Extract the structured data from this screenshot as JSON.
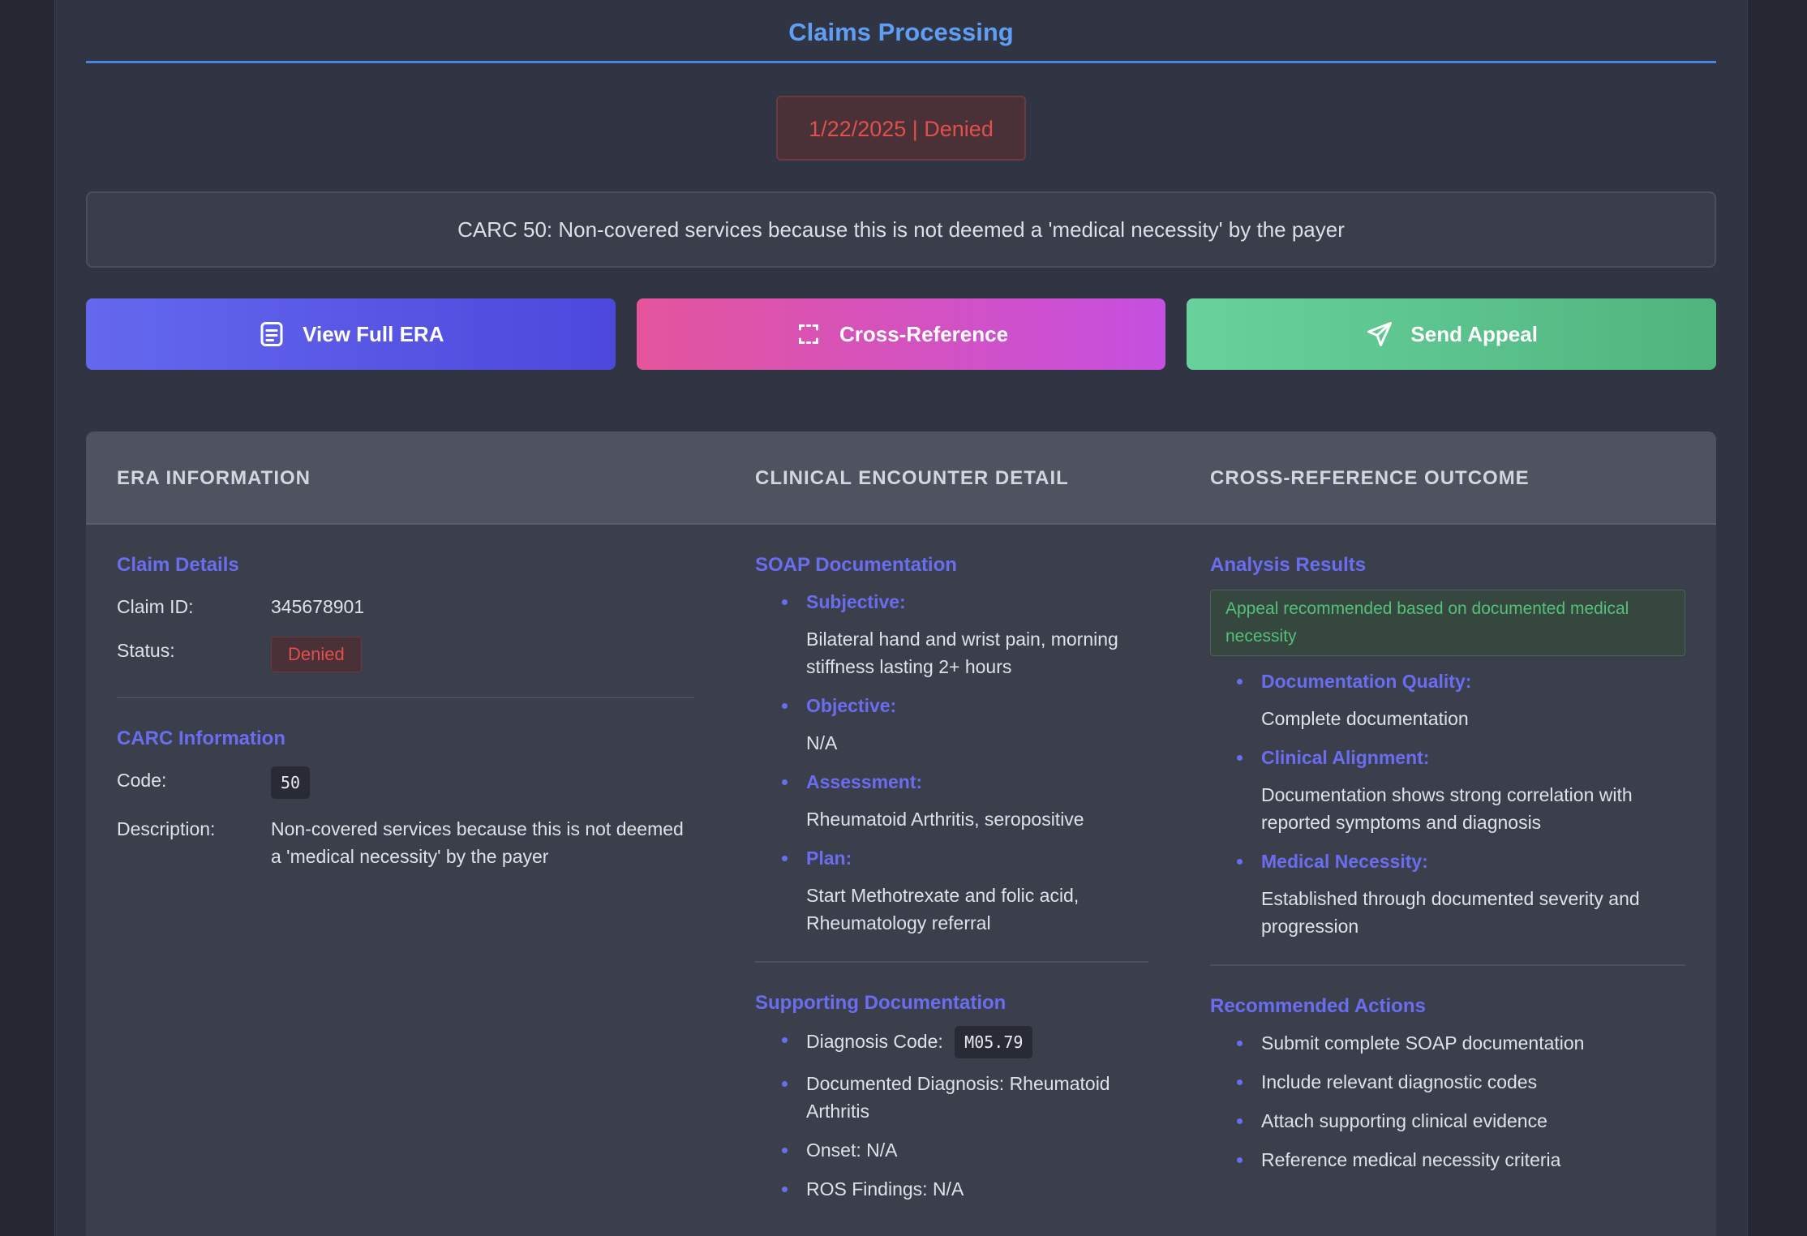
{
  "header": {
    "title": "Claims Processing"
  },
  "status_pill": "1/22/2025 | Denied",
  "carc_banner": "CARC 50: Non-covered services because this is not deemed a 'medical necessity' by the payer",
  "buttons": {
    "view_era": "View Full ERA",
    "cross_reference": "Cross-Reference",
    "send_appeal": "Send Appeal"
  },
  "columns": {
    "era": "ERA INFORMATION",
    "clinical": "CLINICAL ENCOUNTER DETAIL",
    "outcome": "CROSS-REFERENCE OUTCOME"
  },
  "era": {
    "claim_details_title": "Claim Details",
    "claim_id_label": "Claim ID:",
    "claim_id": "345678901",
    "status_label": "Status:",
    "status": "Denied",
    "carc_title": "CARC Information",
    "code_label": "Code:",
    "code": "50",
    "description_label": "Description:",
    "description": "Non-covered services because this is not deemed a 'medical necessity' by the payer"
  },
  "clinical": {
    "soap_title": "SOAP Documentation",
    "soap": [
      {
        "label": "Subjective:",
        "text": "Bilateral hand and wrist pain, morning stiffness lasting 2+ hours"
      },
      {
        "label": "Objective:",
        "text": "N/A"
      },
      {
        "label": "Assessment:",
        "text": "Rheumatoid Arthritis, seropositive"
      },
      {
        "label": "Plan:",
        "text": "Start Methotrexate and folic acid, Rheumatology referral"
      }
    ],
    "supporting_title": "Supporting Documentation",
    "diagnosis_code_label": "Diagnosis Code:",
    "diagnosis_code": "M05.79",
    "supporting": [
      "Documented Diagnosis: Rheumatoid Arthritis",
      "Onset: N/A",
      "ROS Findings: N/A"
    ]
  },
  "outcome": {
    "analysis_title": "Analysis Results",
    "appeal_note": "Appeal recommended based on documented medical necessity",
    "findings": [
      {
        "label": "Documentation Quality:",
        "text": "Complete documentation"
      },
      {
        "label": "Clinical Alignment:",
        "text": "Documentation shows strong correlation with reported symptoms and diagnosis"
      },
      {
        "label": "Medical Necessity:",
        "text": "Established through documented severity and progression"
      }
    ],
    "actions_title": "Recommended Actions",
    "actions": [
      "Submit complete SOAP documentation",
      "Include relevant diagnostic codes",
      "Attach supporting clinical evidence",
      "Reference medical necessity criteria"
    ]
  },
  "colors": {
    "accent": "#5f9ef6",
    "denied": "#e0504d",
    "section_title": "#6a6df0",
    "success": "#55c07a"
  }
}
